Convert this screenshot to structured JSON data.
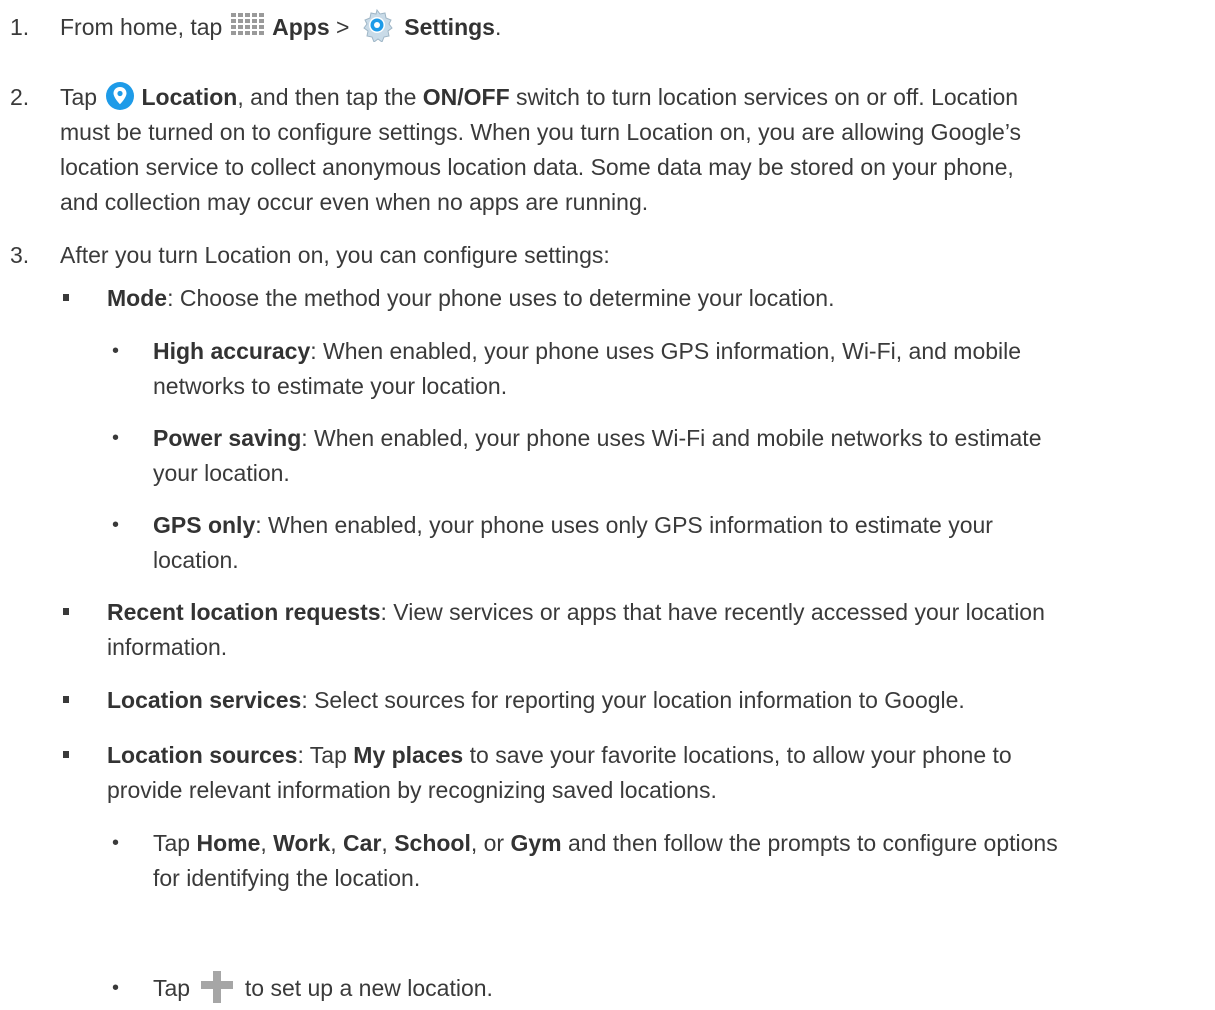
{
  "steps": [
    {
      "number": "1.",
      "parts": {
        "from_home": "From home, tap",
        "apps": "Apps",
        "gt": ">",
        "settings": "Settings",
        "period": "."
      }
    },
    {
      "number": "2.",
      "parts": {
        "tap": "Tap",
        "location": "Location",
        "then_tap": ", and then tap the",
        "onoff": "ON/OFF",
        "rest1": "switch to turn location services on or off. Location",
        "line2": "must be turned on to configure settings. When you turn Location on, you are allowing Google’s",
        "line3": "location service to collect anonymous location data. Some data may be stored on your phone,",
        "line4": "and collection may occur even when no apps are running."
      }
    },
    {
      "number": "3.",
      "parts": {
        "text": "After you turn Location on, you can configure settings:"
      }
    }
  ],
  "mode": {
    "term": "Mode",
    "desc": ": Choose the method your phone uses to determine your location.",
    "options": [
      {
        "term": "High accuracy",
        "line1": ": When enabled, your phone uses GPS information, Wi-Fi, and mobile",
        "line2": "networks to estimate your location."
      },
      {
        "term": "Power saving",
        "line1": ": When enabled, your phone uses Wi-Fi and mobile networks to estimate",
        "line2": "your location."
      },
      {
        "term": "GPS only",
        "line1": ": When enabled, your phone uses only GPS information to estimate your",
        "line2": "location."
      }
    ]
  },
  "recent": {
    "term": "Recent location requests",
    "line1": ": View services or apps that have recently accessed your location",
    "line2": "information."
  },
  "services": {
    "term": "Location services",
    "desc": ": Select sources for reporting your location information to Google."
  },
  "sources": {
    "term": "Location sources",
    "mid": ": Tap",
    "my_places": "My places",
    "line1_rest": "to save your favorite locations, to allow your phone to",
    "line2": "provide relevant information by recognizing saved locations.",
    "sub1": {
      "tap": "Tap",
      "home": "Home",
      "comma1": ",",
      "work": "Work",
      "comma2": ",",
      "car": "Car",
      "comma3": ",",
      "school": "School",
      "or": ", or",
      "gym": "Gym",
      "rest": "and then follow the prompts to configure options",
      "line2": "for identifying the location."
    },
    "sub2": {
      "tap": "Tap",
      "rest": "to set up a new location."
    }
  },
  "bullets": {
    "square": "▪",
    "dot": "•"
  },
  "icons": {
    "apps": "apps-grid-icon",
    "settings": "settings-gear-icon",
    "location": "location-pin-icon",
    "add": "plus-icon"
  },
  "colors": {
    "text": "#3a3a3a",
    "location_blue": "#1e9be8",
    "icon_gray": "#9a9a9a"
  }
}
